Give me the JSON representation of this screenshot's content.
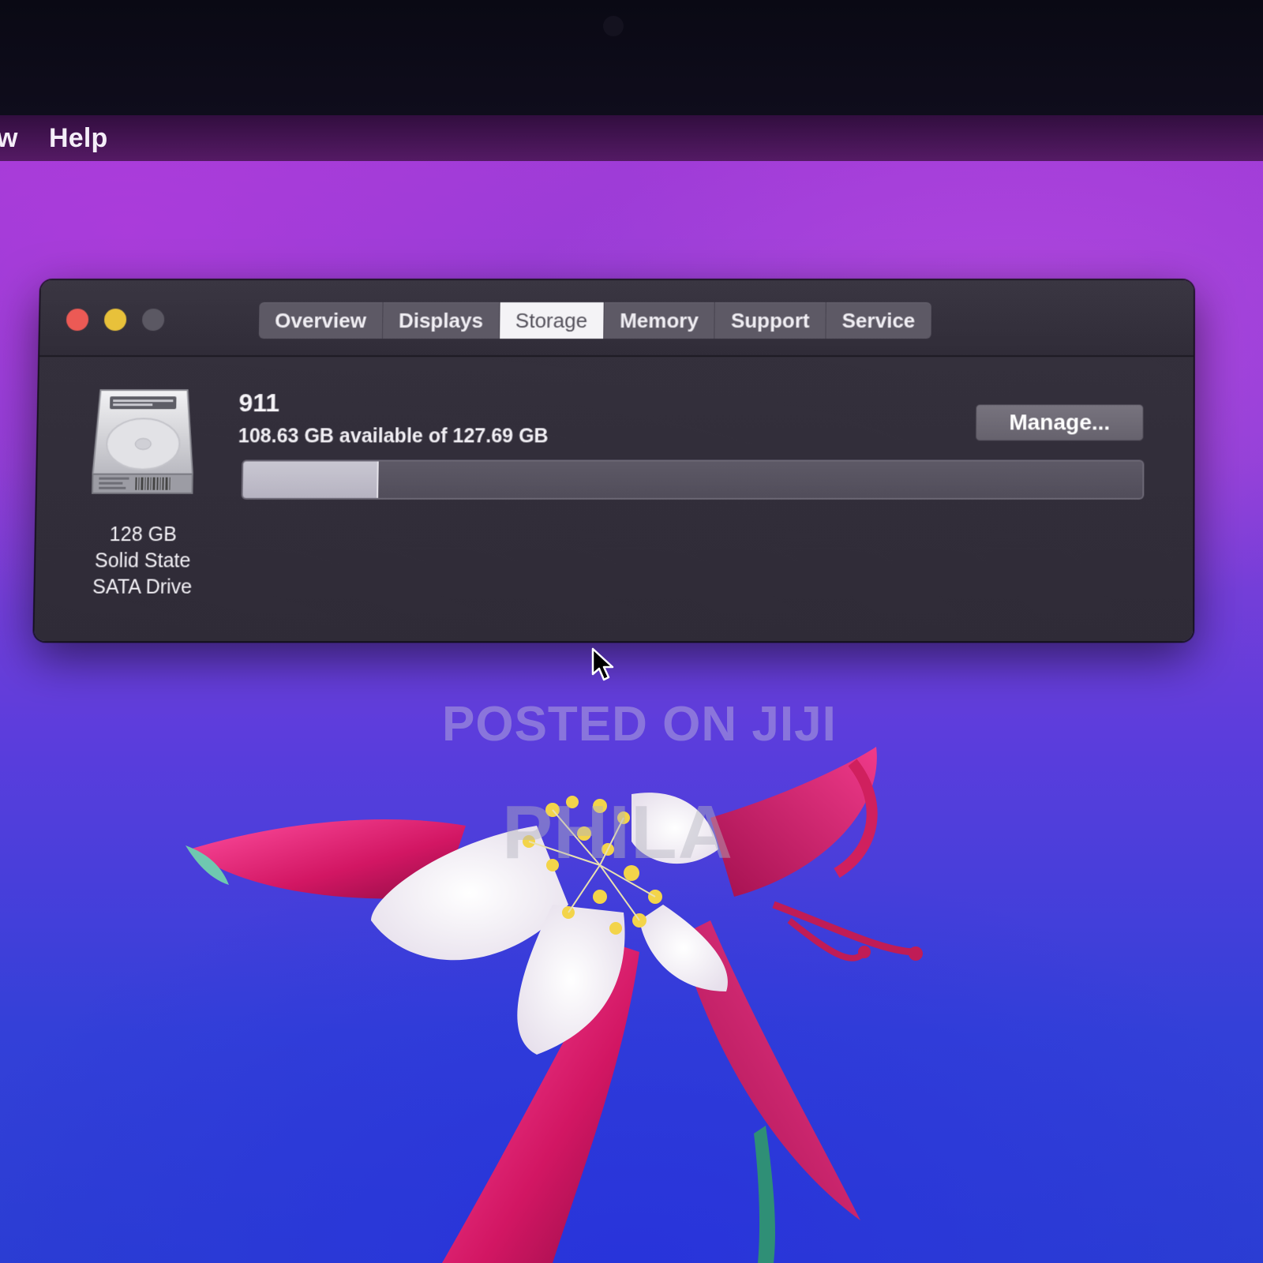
{
  "menubar": {
    "partial_item": "w",
    "help": "Help"
  },
  "window": {
    "tabs": [
      {
        "label": "Overview",
        "active": false
      },
      {
        "label": "Displays",
        "active": false
      },
      {
        "label": "Storage",
        "active": true
      },
      {
        "label": "Memory",
        "active": false
      },
      {
        "label": "Support",
        "active": false
      },
      {
        "label": "Service",
        "active": false
      }
    ],
    "drive": {
      "capacity": "128 GB",
      "type_line1": "Solid State",
      "type_line2": "SATA Drive"
    },
    "volume": {
      "name": "911",
      "capacity_text": "108.63 GB available of 127.69 GB",
      "used_fraction": 0.149
    },
    "manage_label": "Manage..."
  },
  "watermarks": {
    "line1": "POSTED ON JIJI",
    "line2": "PHILA"
  },
  "colors": {
    "close": "#ec5a55",
    "minimize": "#e8c13a",
    "zoom_disabled": "#5b5863"
  }
}
